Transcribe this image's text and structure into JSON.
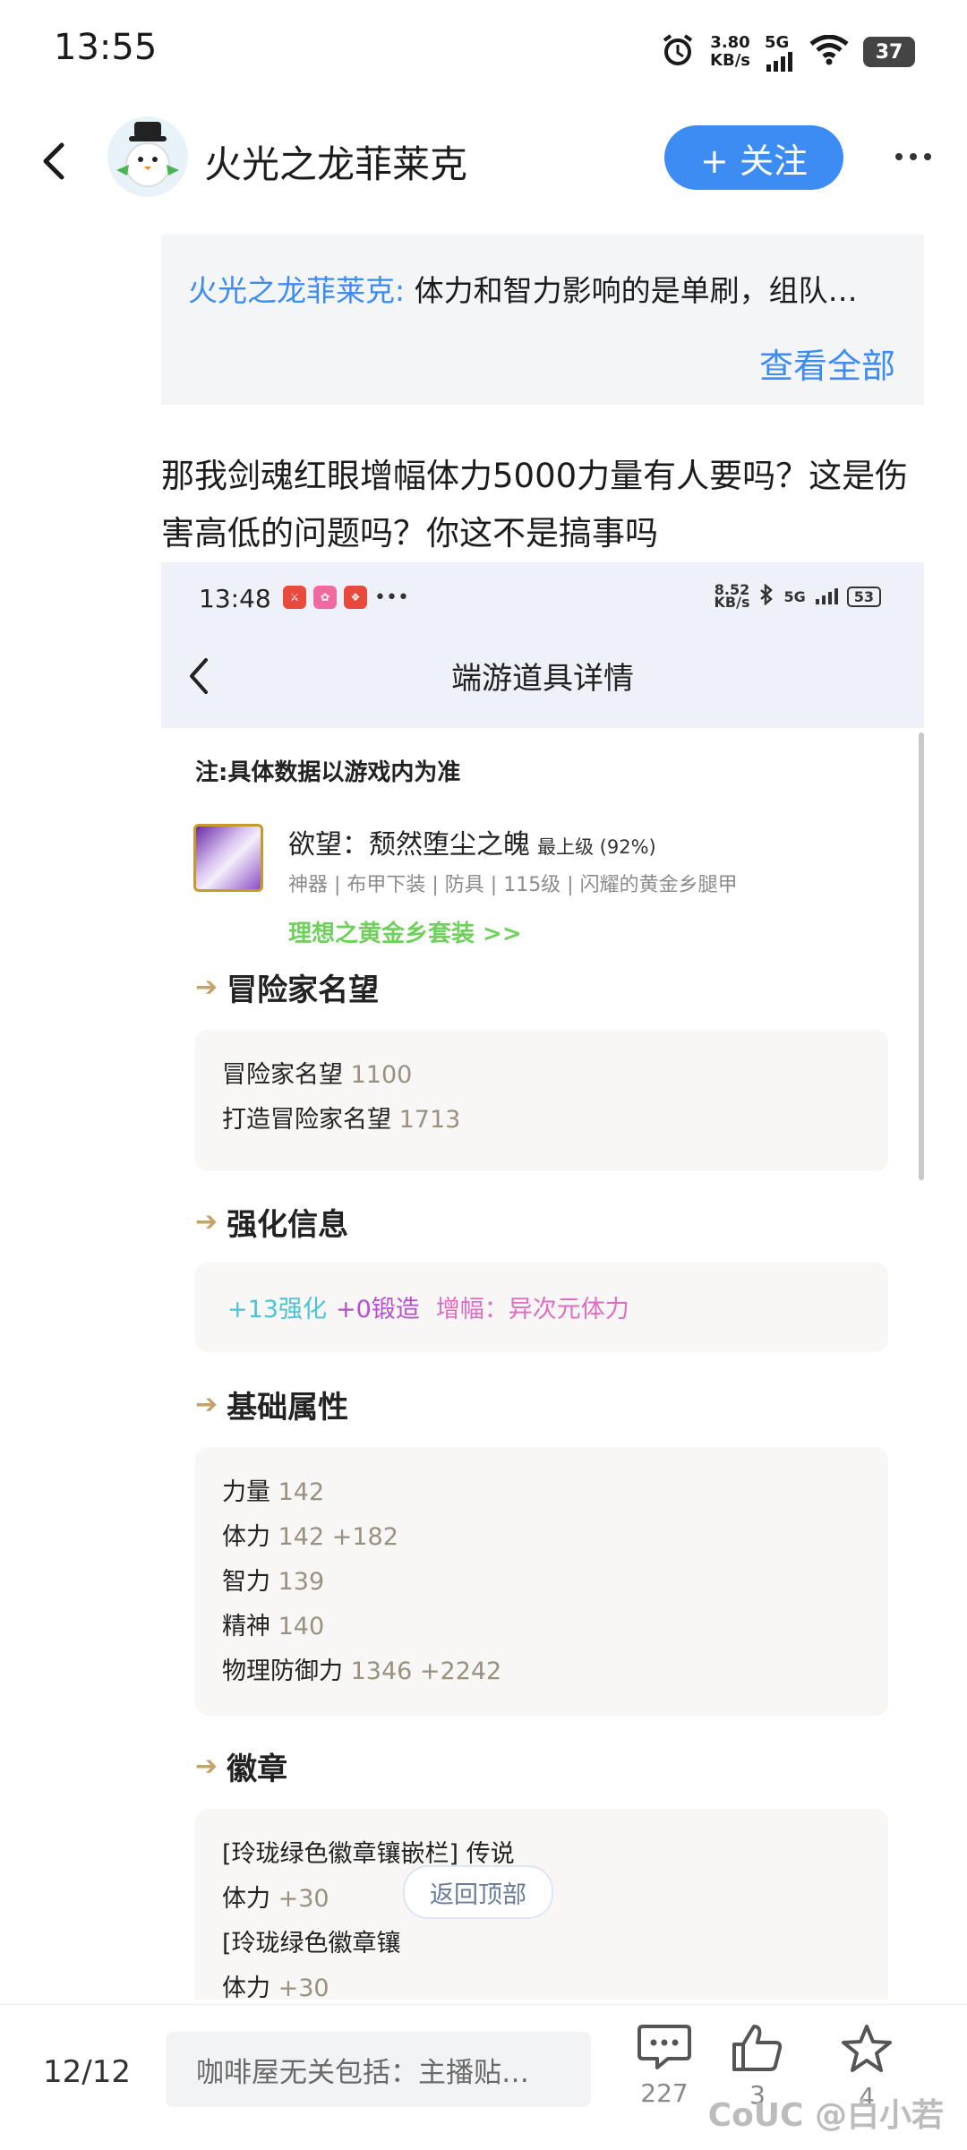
{
  "status_bar": {
    "time": "13:55",
    "net_speed": "3.80",
    "net_unit": "KB/s",
    "signal": "5G",
    "battery": "37"
  },
  "header": {
    "author": "火光之龙菲莱克",
    "follow_label": "+ 关注"
  },
  "quote": {
    "author": "火光之龙菲莱克:",
    "text": "体力和智力影响的是单刷，组队…",
    "view_all": "查看全部"
  },
  "post": {
    "text": "那我剑魂红眼增幅体力5000力量有人要吗？这是伤害高低的问题吗？你这不是搞事吗"
  },
  "screenshot": {
    "status_time": "13:48",
    "status_speed": "8.52",
    "status_speed_unit": "KB/s",
    "status_signal": "5G",
    "status_battery": "53",
    "title": "端游道具详情",
    "note": "注:具体数据以游戏内为准",
    "item": {
      "name": "欲望：颓然堕尘之魄",
      "grade": "最上级 (92%)",
      "tags": "神器 | 布甲下装 | 防具 | 115级 | 闪耀的黄金乡腿甲",
      "set_link": "理想之黄金乡套装  >>"
    },
    "sections": {
      "fame_title": "冒险家名望",
      "fame_rows": [
        {
          "label": "冒险家名望",
          "value": "1100"
        },
        {
          "label": "打造冒险家名望",
          "value": "1713"
        }
      ],
      "enhance_title": "强化信息",
      "enhance": {
        "a": "+13强化",
        "b": "+0锻造",
        "c": "增幅：异次元体力"
      },
      "base_title": "基础属性",
      "base_rows": [
        {
          "label": "力量",
          "value": "142"
        },
        {
          "label": "体力",
          "value": "142 +182"
        },
        {
          "label": "智力",
          "value": "139"
        },
        {
          "label": "精神",
          "value": "140"
        },
        {
          "label": "物理防御力",
          "value": "1346 +2242"
        }
      ],
      "badge_title": "徽章",
      "badge_rows": [
        {
          "label": "[玲珑绿色徽章镶嵌栏] 传说",
          "value": ""
        },
        {
          "label": "体力",
          "value": "+30"
        },
        {
          "label": "[玲珑绿色徽章镶",
          "value": ""
        },
        {
          "label": "体力",
          "value": "+30"
        }
      ]
    },
    "back_to_top": "返回顶部"
  },
  "bottom_bar": {
    "page": "12/12",
    "comment_placeholder": "咖啡屋无关包括：主播贴…",
    "comment_count": "227",
    "like_count": "3",
    "fav_count": "4",
    "watermark": "CoUC @白小若"
  },
  "colors": {
    "accent": "#3c8cf3",
    "set_link": "#6fd15c",
    "enhance": "#4cc4d6",
    "forge": "#b84fd3",
    "amplify": "#e06cc4"
  }
}
